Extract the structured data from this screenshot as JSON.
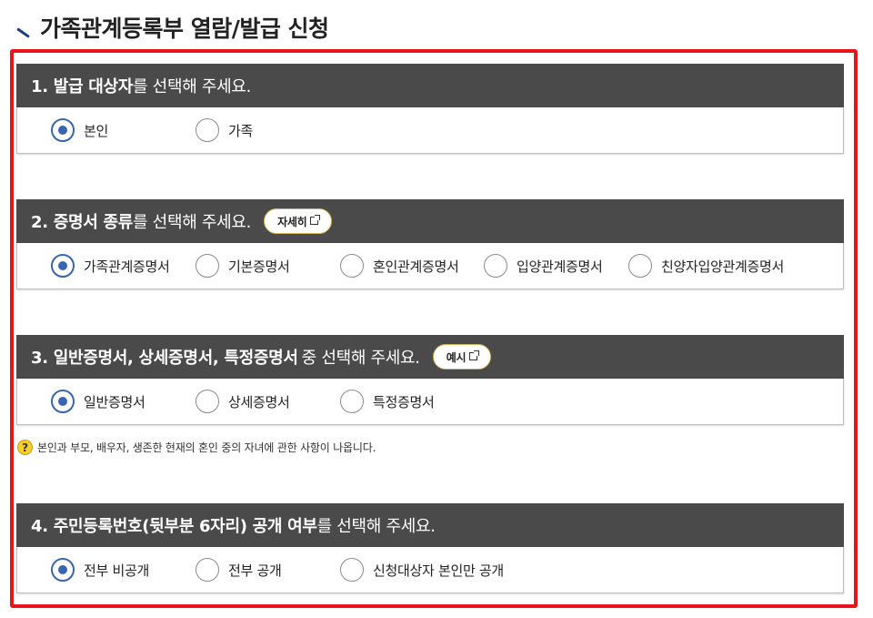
{
  "page": {
    "title": "가족관계등록부 열람/발급 신청"
  },
  "sections": [
    {
      "title_bold": "1. 발급 대상자",
      "title_rest": "를 선택해 주세요.",
      "options": [
        {
          "label": "본인",
          "checked": true
        },
        {
          "label": "가족",
          "checked": false
        }
      ]
    },
    {
      "title_bold": "2. 증명서 종류",
      "title_rest": "를 선택해 주세요.",
      "button_label": "자세히",
      "options": [
        {
          "label": "가족관계증명서",
          "checked": true
        },
        {
          "label": "기본증명서",
          "checked": false
        },
        {
          "label": "혼인관계증명서",
          "checked": false
        },
        {
          "label": "입양관계증명서",
          "checked": false
        },
        {
          "label": "친양자입양관계증명서",
          "checked": false
        }
      ]
    },
    {
      "title_bold": "3. 일반증명서, 상세증명서, 특정증명서",
      "title_rest": "중 선택해 주세요.",
      "button_label": "예시",
      "options": [
        {
          "label": "일반증명서",
          "checked": true
        },
        {
          "label": "상세증명서",
          "checked": false
        },
        {
          "label": "특정증명서",
          "checked": false
        }
      ],
      "note": "본인과 부모, 배우자, 생존한 현재의 혼인 중의 자녀에 관한 사항이 나옵니다."
    },
    {
      "title_bold": "4. 주민등록번호(뒷부분 6자리) 공개 여부",
      "title_rest": "를 선택해 주세요.",
      "options": [
        {
          "label": "전부 비공개",
          "checked": true
        },
        {
          "label": "전부 공개",
          "checked": false
        },
        {
          "label": "신청대상자 본인만 공개",
          "checked": false
        }
      ]
    }
  ],
  "colors": {
    "header_bg": "#4a4a4a",
    "accent": "#3a64b0",
    "highlight_border": "#e8141c",
    "button_border": "#d8b45a",
    "help_icon": "#f6cf2e"
  }
}
